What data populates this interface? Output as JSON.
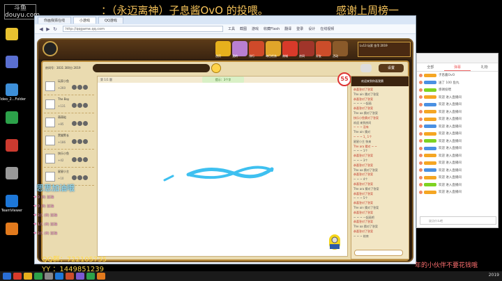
{
  "overlay": {
    "ticker": "：（永迈离神）子息酱OvO 的投喂。",
    "thanks": "感谢上周榜一",
    "logo": "斗鱼 douyu.com",
    "cheer": "思思加油哦",
    "qq": "QQ群：722105735",
    "yy": "YY ：1449851239",
    "notice": "年的小伙伴不要花钱哦"
  },
  "desktop": {
    "icons": [
      {
        "name": "app-icon-1",
        "label": ""
      },
      {
        "name": "app-icon-2",
        "label": ""
      },
      {
        "name": "app-icon-3",
        "label": "Video_2...Folder"
      },
      {
        "name": "app-icon-4",
        "label": ""
      },
      {
        "name": "app-icon-5",
        "label": ""
      },
      {
        "name": "app-icon-6",
        "label": ""
      },
      {
        "name": "teamviewer-icon",
        "label": "TeamViewer"
      },
      {
        "name": "app-icon-8",
        "label": ""
      }
    ]
  },
  "browser": {
    "tabs": [
      "你画我猜在线",
      "小游戏",
      "QQ游戏"
    ],
    "address": "http://qqgame.qq.com",
    "toolbar": [
      "工具",
      "截图",
      "游戏",
      "收藏Flash",
      "翻译",
      "登录",
      "设计",
      "在线视频"
    ]
  },
  "game": {
    "tabs": [
      "首页",
      "我的",
      "排行",
      "每日任务",
      "商城",
      "房间",
      "好友",
      "活动"
    ],
    "room": "房间号：3031 300分 2019",
    "timer": "55",
    "hint": "提示：3个字",
    "canvas_label": "第 1/1 题",
    "player_info": "Lv13 玩家 金币 2019",
    "chat_title": "欢迎来到你画我猜",
    "players": [
      {
        "name": "玩家小鱼",
        "stats": "+260"
      },
      {
        "name": "The Boy",
        "stats": "+131"
      },
      {
        "name": "萌萌哒",
        "stats": "+85"
      },
      {
        "name": "黑猫警长",
        "stats": "+186"
      },
      {
        "name": "快乐小鱼",
        "stats": "+42"
      },
      {
        "name": "星星小主",
        "stats": "+10"
      }
    ],
    "chat": [
      {
        "cls": "sys",
        "text": "恭喜答对了答案"
      },
      {
        "cls": "usr",
        "text": "The ain 猜对了答案"
      },
      {
        "cls": "sys",
        "text": "恭喜答对了答案"
      },
      {
        "cls": "usr",
        "text": "~ ~ ~ 一起画"
      },
      {
        "cls": "sys",
        "text": "恭喜答对了答案"
      },
      {
        "cls": "usr",
        "text": "The aa 猜对了答案"
      },
      {
        "cls": "sys",
        "text": "快乐小鱼猜对了答案"
      },
      {
        "cls": "usr",
        "text": "欢迎 来到房间"
      },
      {
        "cls": "sys",
        "text": "~ ~ ~ 没有"
      },
      {
        "cls": "usr",
        "text": "The ain 猜对"
      },
      {
        "cls": "sys",
        "text": "~ ~ ~ 1_ 1个"
      },
      {
        "cls": "usr",
        "text": "星星小主 快来"
      },
      {
        "cls": "sys",
        "text": "The ara 猜对 ~ ~"
      },
      {
        "cls": "usr",
        "text": "~ ~ ~ 1个"
      },
      {
        "cls": "sys",
        "text": "恭喜答对了答案"
      },
      {
        "cls": "usr",
        "text": "~ ~ ~ 3个"
      },
      {
        "cls": "sys",
        "text": "恭喜答对了答案"
      },
      {
        "cls": "usr",
        "text": "The aa 猜对了答案"
      },
      {
        "cls": "sys",
        "text": "恭喜答对了答案"
      },
      {
        "cls": "usr",
        "text": "~ ~ ~ 4个"
      },
      {
        "cls": "sys",
        "text": "恭喜答对了答案"
      },
      {
        "cls": "usr",
        "text": "The ara 猜对了答案"
      },
      {
        "cls": "sys",
        "text": "恭喜答对了答案"
      },
      {
        "cls": "usr",
        "text": "~ ~ ~ 5个"
      },
      {
        "cls": "sys",
        "text": "恭喜答对了答案"
      },
      {
        "cls": "usr",
        "text": "The ain 猜对了答案"
      },
      {
        "cls": "sys",
        "text": "恭喜答对了答案"
      },
      {
        "cls": "usr",
        "text": "~ ~ ~ 一起画吧"
      },
      {
        "cls": "sys",
        "text": "恭喜答对了答案"
      },
      {
        "cls": "usr",
        "text": "The aa 猜对了答案"
      },
      {
        "cls": "sys",
        "text": "恭喜答对了答案"
      },
      {
        "cls": "usr",
        "text": "~ ~ ~ 结束"
      }
    ]
  },
  "side": {
    "tabs": [
      "全部",
      "弹幕",
      "礼物"
    ],
    "rows": [
      {
        "text": "子息酱OvO",
        "color": "#f5a623"
      },
      {
        "text": "送了 100 鱼丸",
        "color": "#4a90e2"
      },
      {
        "text": "感谢投喂",
        "color": "#7ed321"
      },
      {
        "text": "欢迎 进入直播间",
        "color": "#f5a623"
      },
      {
        "text": "欢迎 进入直播间",
        "color": "#4a90e2"
      },
      {
        "text": "欢迎 进入直播间",
        "color": "#f5a623"
      },
      {
        "text": "欢迎 进入直播间",
        "color": "#f5a623"
      },
      {
        "text": "欢迎 进入直播间",
        "color": "#4a90e2"
      },
      {
        "text": "欢迎 进入直播间",
        "color": "#f5a623"
      },
      {
        "text": "欢迎 进入直播间",
        "color": "#7ed321"
      },
      {
        "text": "欢迎 进入直播间",
        "color": "#4a90e2"
      },
      {
        "text": "欢迎 进入直播间",
        "color": "#f5a623"
      },
      {
        "text": "欢迎 进入直播间",
        "color": "#f5a623"
      },
      {
        "text": "欢迎 进入直播间",
        "color": "#4a90e2"
      },
      {
        "text": "欢迎 进入直播间",
        "color": "#f5a623"
      },
      {
        "text": "欢迎 进入直播间",
        "color": "#7ed321"
      },
      {
        "text": "欢迎 进入直播间",
        "color": "#f5a623"
      }
    ],
    "input_placeholder": "说点什么吧"
  },
  "hearts": [
    "❤ 0 (8) 加油",
    "❤ 0 (8) 加油",
    "❤ 2/1 (8) 加油",
    "❤ 1/1 (8) 加油",
    "❤ 2/1 (8) 加油"
  ],
  "clock": "2019"
}
